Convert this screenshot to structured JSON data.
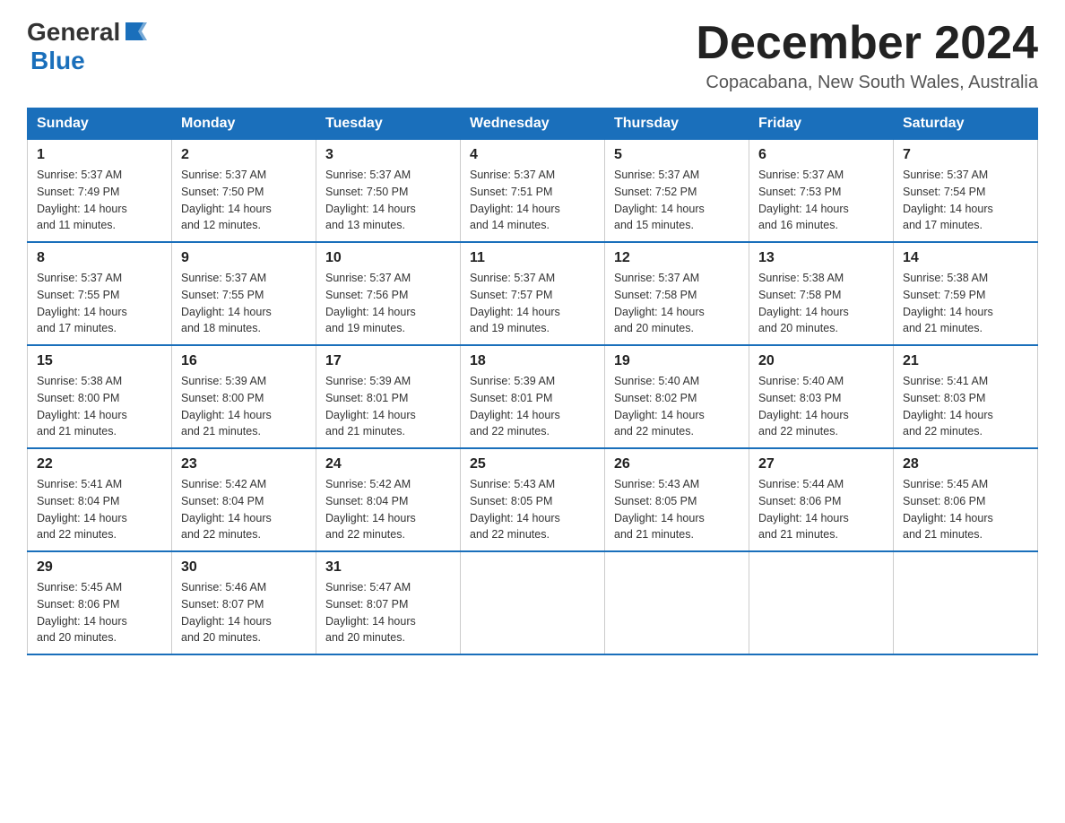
{
  "header": {
    "logo_general": "General",
    "logo_blue": "Blue",
    "month_title": "December 2024",
    "location": "Copacabana, New South Wales, Australia"
  },
  "weekdays": [
    "Sunday",
    "Monday",
    "Tuesday",
    "Wednesday",
    "Thursday",
    "Friday",
    "Saturday"
  ],
  "weeks": [
    [
      {
        "day": "1",
        "sunrise": "5:37 AM",
        "sunset": "7:49 PM",
        "daylight": "14 hours and 11 minutes."
      },
      {
        "day": "2",
        "sunrise": "5:37 AM",
        "sunset": "7:50 PM",
        "daylight": "14 hours and 12 minutes."
      },
      {
        "day": "3",
        "sunrise": "5:37 AM",
        "sunset": "7:50 PM",
        "daylight": "14 hours and 13 minutes."
      },
      {
        "day": "4",
        "sunrise": "5:37 AM",
        "sunset": "7:51 PM",
        "daylight": "14 hours and 14 minutes."
      },
      {
        "day": "5",
        "sunrise": "5:37 AM",
        "sunset": "7:52 PM",
        "daylight": "14 hours and 15 minutes."
      },
      {
        "day": "6",
        "sunrise": "5:37 AM",
        "sunset": "7:53 PM",
        "daylight": "14 hours and 16 minutes."
      },
      {
        "day": "7",
        "sunrise": "5:37 AM",
        "sunset": "7:54 PM",
        "daylight": "14 hours and 17 minutes."
      }
    ],
    [
      {
        "day": "8",
        "sunrise": "5:37 AM",
        "sunset": "7:55 PM",
        "daylight": "14 hours and 17 minutes."
      },
      {
        "day": "9",
        "sunrise": "5:37 AM",
        "sunset": "7:55 PM",
        "daylight": "14 hours and 18 minutes."
      },
      {
        "day": "10",
        "sunrise": "5:37 AM",
        "sunset": "7:56 PM",
        "daylight": "14 hours and 19 minutes."
      },
      {
        "day": "11",
        "sunrise": "5:37 AM",
        "sunset": "7:57 PM",
        "daylight": "14 hours and 19 minutes."
      },
      {
        "day": "12",
        "sunrise": "5:37 AM",
        "sunset": "7:58 PM",
        "daylight": "14 hours and 20 minutes."
      },
      {
        "day": "13",
        "sunrise": "5:38 AM",
        "sunset": "7:58 PM",
        "daylight": "14 hours and 20 minutes."
      },
      {
        "day": "14",
        "sunrise": "5:38 AM",
        "sunset": "7:59 PM",
        "daylight": "14 hours and 21 minutes."
      }
    ],
    [
      {
        "day": "15",
        "sunrise": "5:38 AM",
        "sunset": "8:00 PM",
        "daylight": "14 hours and 21 minutes."
      },
      {
        "day": "16",
        "sunrise": "5:39 AM",
        "sunset": "8:00 PM",
        "daylight": "14 hours and 21 minutes."
      },
      {
        "day": "17",
        "sunrise": "5:39 AM",
        "sunset": "8:01 PM",
        "daylight": "14 hours and 21 minutes."
      },
      {
        "day": "18",
        "sunrise": "5:39 AM",
        "sunset": "8:01 PM",
        "daylight": "14 hours and 22 minutes."
      },
      {
        "day": "19",
        "sunrise": "5:40 AM",
        "sunset": "8:02 PM",
        "daylight": "14 hours and 22 minutes."
      },
      {
        "day": "20",
        "sunrise": "5:40 AM",
        "sunset": "8:03 PM",
        "daylight": "14 hours and 22 minutes."
      },
      {
        "day": "21",
        "sunrise": "5:41 AM",
        "sunset": "8:03 PM",
        "daylight": "14 hours and 22 minutes."
      }
    ],
    [
      {
        "day": "22",
        "sunrise": "5:41 AM",
        "sunset": "8:04 PM",
        "daylight": "14 hours and 22 minutes."
      },
      {
        "day": "23",
        "sunrise": "5:42 AM",
        "sunset": "8:04 PM",
        "daylight": "14 hours and 22 minutes."
      },
      {
        "day": "24",
        "sunrise": "5:42 AM",
        "sunset": "8:04 PM",
        "daylight": "14 hours and 22 minutes."
      },
      {
        "day": "25",
        "sunrise": "5:43 AM",
        "sunset": "8:05 PM",
        "daylight": "14 hours and 22 minutes."
      },
      {
        "day": "26",
        "sunrise": "5:43 AM",
        "sunset": "8:05 PM",
        "daylight": "14 hours and 21 minutes."
      },
      {
        "day": "27",
        "sunrise": "5:44 AM",
        "sunset": "8:06 PM",
        "daylight": "14 hours and 21 minutes."
      },
      {
        "day": "28",
        "sunrise": "5:45 AM",
        "sunset": "8:06 PM",
        "daylight": "14 hours and 21 minutes."
      }
    ],
    [
      {
        "day": "29",
        "sunrise": "5:45 AM",
        "sunset": "8:06 PM",
        "daylight": "14 hours and 20 minutes."
      },
      {
        "day": "30",
        "sunrise": "5:46 AM",
        "sunset": "8:07 PM",
        "daylight": "14 hours and 20 minutes."
      },
      {
        "day": "31",
        "sunrise": "5:47 AM",
        "sunset": "8:07 PM",
        "daylight": "14 hours and 20 minutes."
      },
      null,
      null,
      null,
      null
    ]
  ],
  "labels": {
    "sunrise": "Sunrise:",
    "sunset": "Sunset:",
    "daylight": "Daylight:"
  }
}
